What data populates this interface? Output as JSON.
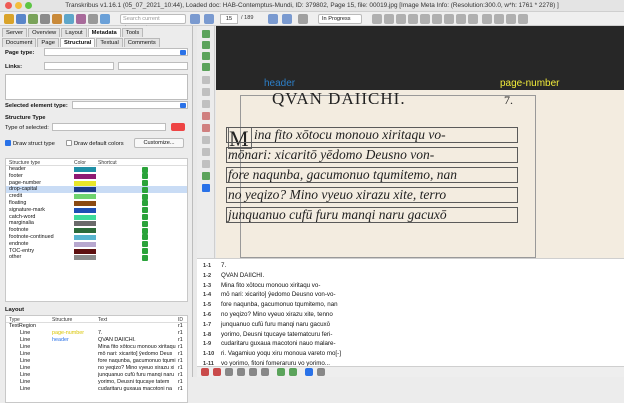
{
  "window": {
    "title": "Transkribus v1.16.1 (05_07_2021_10:44), Loaded doc: HAB-Contemptus-Mundi, ID: 379802, Page 15, file: 00019.jpg [Image Meta Info: (Resolution:300.0, w*h: 1761 * 2278) ]"
  },
  "toolbar": {
    "search_placeholder": "Search current document...",
    "page_value": "15",
    "page_total": "/ 189",
    "status_value": "In Progress"
  },
  "left_panel": {
    "top_tabs": [
      "Server",
      "Overview",
      "Layout",
      "Metadata",
      "Tools"
    ],
    "sub_tabs": [
      "Document",
      "Page",
      "Structural",
      "Textual",
      "Comments"
    ],
    "page_type_label": "Page type:",
    "links_label": "Links:",
    "selected_element_type_label": "Selected element type:",
    "structure_type_label": "Structure Type",
    "type_of_selected_label": "Type of selected:",
    "draw_struct_label": "Draw struct type",
    "draw_default_colors_label": "Draw default colors",
    "customize_label": "Customize...",
    "struct_table": {
      "headers": [
        "Structure type",
        "Color",
        "Shortcut"
      ],
      "rows": [
        {
          "name": "header",
          "color": "#1f8fa6"
        },
        {
          "name": "footer",
          "color": "#8e1a73"
        },
        {
          "name": "page-number",
          "color": "#e9e62a"
        },
        {
          "name": "drop-capital",
          "color": "#1e3a8a"
        },
        {
          "name": "credit",
          "color": "#6fd36f"
        },
        {
          "name": "floating",
          "color": "#8a4a12"
        },
        {
          "name": "signature-mark",
          "color": "#1e4fb5"
        },
        {
          "name": "catch-word",
          "color": "#3ddb9a"
        },
        {
          "name": "marginalia",
          "color": "#6a6a6a"
        },
        {
          "name": "footnote",
          "color": "#2c6b3a"
        },
        {
          "name": "footnote-continued",
          "color": "#57b5cf"
        },
        {
          "name": "endnote",
          "color": "#b8a8cf"
        },
        {
          "name": "TOC-entry",
          "color": "#5d1010"
        },
        {
          "name": "other",
          "color": "#8a8a8a"
        }
      ]
    },
    "layout_label": "Layout",
    "layout_table": {
      "headers": [
        "Type",
        "Structure",
        "Text",
        "ID"
      ],
      "rows": [
        {
          "type": "TextRegion",
          "structure": "",
          "text": "",
          "id": "r1"
        },
        {
          "type": "Line",
          "structure": "page-number",
          "text": "7.",
          "id": "r1"
        },
        {
          "type": "Line",
          "structure": "header",
          "text": "QVAN DAIICHI.",
          "id": "r1"
        },
        {
          "type": "Line",
          "structure": "",
          "text": "Mina fito xōtocu monouo xiritaqu",
          "id": "r1"
        },
        {
          "type": "Line",
          "structure": "",
          "text": "mō nari: xicarito] ŷedomo Deus",
          "id": "r1"
        },
        {
          "type": "Line",
          "structure": "",
          "text": "fore naqunba, gacumonuo tqumi",
          "id": "r1"
        },
        {
          "type": "Line",
          "structure": "",
          "text": "no yeqizo? Mino vyeuo xirazu xi",
          "id": "r1"
        },
        {
          "type": "Line",
          "structure": "",
          "text": "junquanuo cufū furu manqi naru",
          "id": "r1"
        },
        {
          "type": "Line",
          "structure": "",
          "text": "yorimo, Deusni tqucaye tatem",
          "id": "r1"
        },
        {
          "type": "Line",
          "structure": "",
          "text": "cudaritaru guxaua macotoni na",
          "id": "r1"
        }
      ]
    }
  },
  "canvas": {
    "header_label": "header",
    "page_number_label": "page-number",
    "header_text": "QVAN DAIICHI.",
    "page_number_text": "7.",
    "drop_cap": "M",
    "lines": [
      "ina fito xōtocu monouo xiritaqu vo-",
      "mōnari: xicaritō yēdomo Deusno von-",
      "fore naqunba, gacumonuo tqumitemo, nan",
      "no yeqizo? Mino vyeuo xirazu xite, terro",
      "junquanuo cufū furu manqi naru gacuxō"
    ]
  },
  "text_panel": {
    "rows": [
      {
        "num": "1-1",
        "text": "7."
      },
      {
        "num": "1-2",
        "text": "QVAN DAIICHI."
      },
      {
        "num": "1-3",
        "text": "Mina fito xōtocu monouo xiritaqu vo-"
      },
      {
        "num": "1-4",
        "text": "mō nari: xicarito] ŷedomo Deusno von-vo-"
      },
      {
        "num": "1-5",
        "text": "fore naqunba, gacumonuo tqumitemo, nan"
      },
      {
        "num": "1-6",
        "text": "no yeqizo? Mino vyeuo xirazu xite, tenno"
      },
      {
        "num": "1-7",
        "text": "junquanuo cufū furu manqi naru gacuxō"
      },
      {
        "num": "1-8",
        "text": "yorimo, Deusni tqucaye tatematcuru feri-"
      },
      {
        "num": "1-9",
        "text": "cudaritaru guxaua macotoni nauo malare-"
      },
      {
        "num": "1-10",
        "text": "ri. Vagamiuo yoqu xiru monoua vareto mo[-]"
      },
      {
        "num": "1-11",
        "text": "vo yorimo, fitoni fomeraruru vo yorimo..."
      }
    ]
  }
}
